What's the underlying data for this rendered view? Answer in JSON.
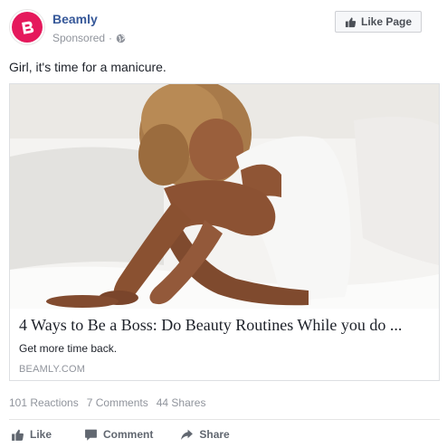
{
  "post": {
    "page_name": "Beamly",
    "sponsored_label": "Sponsored",
    "meta_separator": "·",
    "like_page_label": "Like Page",
    "message": "Girl, it's time for a manicure."
  },
  "link_card": {
    "title": "4 Ways to Be a Boss: Do Beauty Routines While you do ...",
    "description": "Get more time back.",
    "domain": "BEAMLY.COM"
  },
  "stats": {
    "reactions": "101 Reactions",
    "comments": "7 Comments",
    "shares": "44 Shares"
  },
  "actions": {
    "like": "Like",
    "comment": "Comment",
    "share": "Share"
  },
  "colors": {
    "brand_pink": "#e5195c",
    "link_blue": "#365899",
    "meta_gray": "#90949c"
  },
  "icons": {
    "avatar": "beamly-logo-icon",
    "privacy": "globe-icon",
    "like_page": "thumbs-up-icon",
    "like": "thumbs-up-icon",
    "comment": "comment-icon",
    "share": "share-icon"
  }
}
